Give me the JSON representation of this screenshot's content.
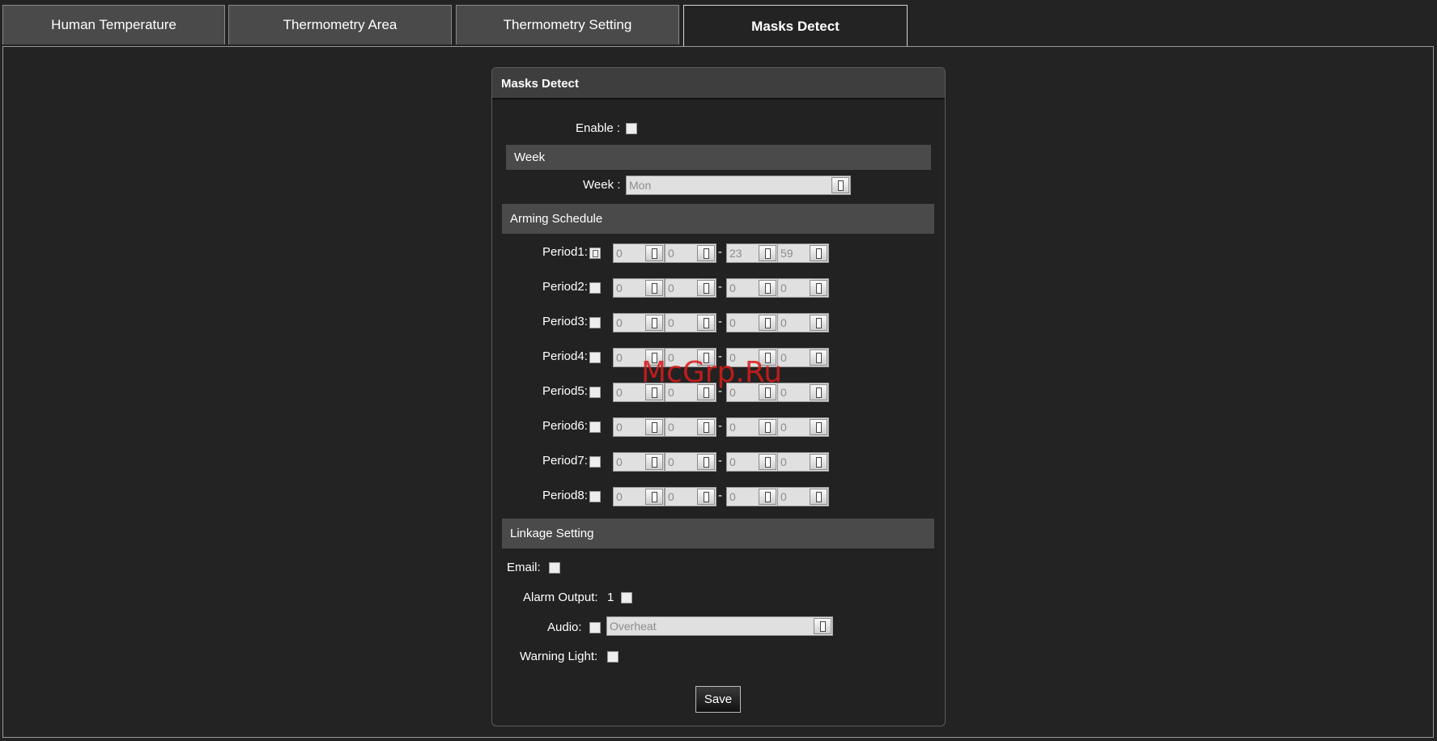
{
  "tabs": [
    {
      "label": "Human Temperature"
    },
    {
      "label": "Thermometry Area"
    },
    {
      "label": "Thermometry Setting"
    },
    {
      "label": "Masks Detect"
    }
  ],
  "panel": {
    "title": "Masks Detect",
    "enable_label": "Enable :",
    "week_section": "Week",
    "week_label": "Week :",
    "week_value": "Mon",
    "arming_section": "Arming Schedule",
    "periods": [
      {
        "label": "Period1:",
        "start_h": "0",
        "start_m": "0",
        "end_h": "23",
        "end_m": "59"
      },
      {
        "label": "Period2:",
        "start_h": "0",
        "start_m": "0",
        "end_h": "0",
        "end_m": "0"
      },
      {
        "label": "Period3:",
        "start_h": "0",
        "start_m": "0",
        "end_h": "0",
        "end_m": "0"
      },
      {
        "label": "Period4:",
        "start_h": "0",
        "start_m": "0",
        "end_h": "0",
        "end_m": "0"
      },
      {
        "label": "Period5:",
        "start_h": "0",
        "start_m": "0",
        "end_h": "0",
        "end_m": "0"
      },
      {
        "label": "Period6:",
        "start_h": "0",
        "start_m": "0",
        "end_h": "0",
        "end_m": "0"
      },
      {
        "label": "Period7:",
        "start_h": "0",
        "start_m": "0",
        "end_h": "0",
        "end_m": "0"
      },
      {
        "label": "Period8:",
        "start_h": "0",
        "start_m": "0",
        "end_h": "0",
        "end_m": "0"
      }
    ],
    "dash": "-",
    "linkage_section": "Linkage Setting",
    "email_label": "Email:",
    "alarm_output_label": "Alarm Output:",
    "alarm_output_channel": "1",
    "audio_label": "Audio:",
    "audio_value": "Overheat",
    "warning_light_label": "Warning Light:",
    "save_label": "Save"
  },
  "watermark": "McGrp.Ru"
}
